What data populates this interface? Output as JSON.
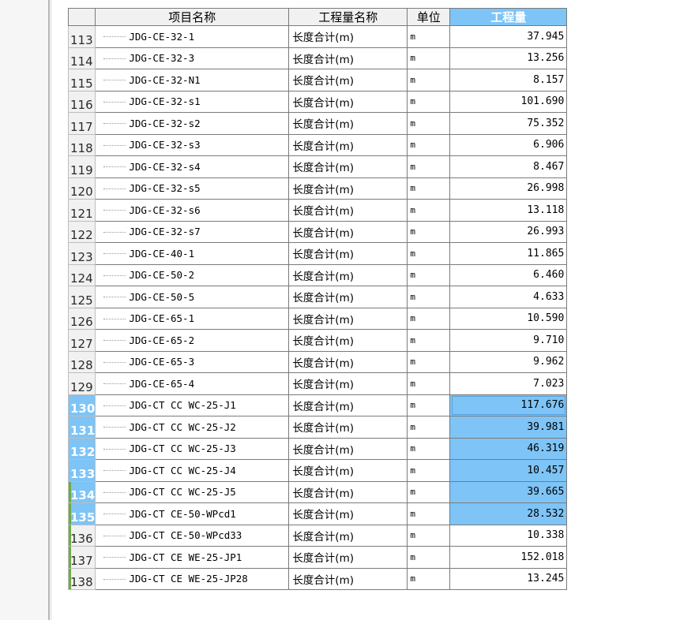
{
  "grid": {
    "headers": {
      "name": "项目名称",
      "quantity_name": "工程量名称",
      "unit": "单位",
      "quantity": "工程量"
    },
    "rows": [
      {
        "num": "113",
        "name": "JDG-CE-32-1",
        "qname": "长度合计(m)",
        "unit": "m",
        "value": "37.945"
      },
      {
        "num": "114",
        "name": "JDG-CE-32-3",
        "qname": "长度合计(m)",
        "unit": "m",
        "value": "13.256"
      },
      {
        "num": "115",
        "name": "JDG-CE-32-N1",
        "qname": "长度合计(m)",
        "unit": "m",
        "value": "8.157"
      },
      {
        "num": "116",
        "name": "JDG-CE-32-s1",
        "qname": "长度合计(m)",
        "unit": "m",
        "value": "101.690"
      },
      {
        "num": "117",
        "name": "JDG-CE-32-s2",
        "qname": "长度合计(m)",
        "unit": "m",
        "value": "75.352"
      },
      {
        "num": "118",
        "name": "JDG-CE-32-s3",
        "qname": "长度合计(m)",
        "unit": "m",
        "value": "6.906"
      },
      {
        "num": "119",
        "name": "JDG-CE-32-s4",
        "qname": "长度合计(m)",
        "unit": "m",
        "value": "8.467"
      },
      {
        "num": "120",
        "name": "JDG-CE-32-s5",
        "qname": "长度合计(m)",
        "unit": "m",
        "value": "26.998"
      },
      {
        "num": "121",
        "name": "JDG-CE-32-s6",
        "qname": "长度合计(m)",
        "unit": "m",
        "value": "13.118"
      },
      {
        "num": "122",
        "name": "JDG-CE-32-s7",
        "qname": "长度合计(m)",
        "unit": "m",
        "value": "26.993"
      },
      {
        "num": "123",
        "name": "JDG-CE-40-1",
        "qname": "长度合计(m)",
        "unit": "m",
        "value": "11.865"
      },
      {
        "num": "124",
        "name": "JDG-CE-50-2",
        "qname": "长度合计(m)",
        "unit": "m",
        "value": "6.460"
      },
      {
        "num": "125",
        "name": "JDG-CE-50-5",
        "qname": "长度合计(m)",
        "unit": "m",
        "value": "4.633"
      },
      {
        "num": "126",
        "name": "JDG-CE-65-1",
        "qname": "长度合计(m)",
        "unit": "m",
        "value": "10.590"
      },
      {
        "num": "127",
        "name": "JDG-CE-65-2",
        "qname": "长度合计(m)",
        "unit": "m",
        "value": "9.710"
      },
      {
        "num": "128",
        "name": "JDG-CE-65-3",
        "qname": "长度合计(m)",
        "unit": "m",
        "value": "9.962"
      },
      {
        "num": "129",
        "name": "JDG-CE-65-4",
        "qname": "长度合计(m)",
        "unit": "m",
        "value": "7.023"
      },
      {
        "num": "130",
        "name": "JDG-CT CC WC-25-J1",
        "qname": "长度合计(m)",
        "unit": "m",
        "value": "117.676"
      },
      {
        "num": "131",
        "name": "JDG-CT CC WC-25-J2",
        "qname": "长度合计(m)",
        "unit": "m",
        "value": "39.981"
      },
      {
        "num": "132",
        "name": "JDG-CT CC WC-25-J3",
        "qname": "长度合计(m)",
        "unit": "m",
        "value": "46.319"
      },
      {
        "num": "133",
        "name": "JDG-CT CC WC-25-J4",
        "qname": "长度合计(m)",
        "unit": "m",
        "value": "10.457"
      },
      {
        "num": "134",
        "name": "JDG-CT CC WC-25-J5",
        "qname": "长度合计(m)",
        "unit": "m",
        "value": "39.665"
      },
      {
        "num": "135",
        "name": "JDG-CT CE-50-WPcd1",
        "qname": "长度合计(m)",
        "unit": "m",
        "value": "28.532"
      },
      {
        "num": "136",
        "name": "JDG-CT CE-50-WPcd33",
        "qname": "长度合计(m)",
        "unit": "m",
        "value": "10.338"
      },
      {
        "num": "137",
        "name": "JDG-CT CE WE-25-JP1",
        "qname": "长度合计(m)",
        "unit": "m",
        "value": "152.018"
      },
      {
        "num": "138",
        "name": "JDG-CT CE WE-25-JP28",
        "qname": "长度合计(m)",
        "unit": "m",
        "value": "13.245"
      }
    ],
    "colors": {
      "selection": "#7ec4f6",
      "group_marker": "#6cad45",
      "grid_line": "#7a7a7a"
    }
  }
}
